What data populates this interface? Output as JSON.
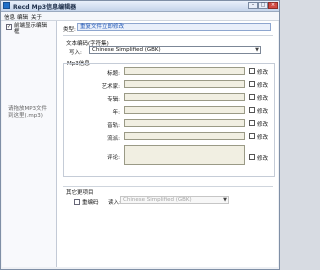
{
  "window": {
    "title": "Recd Mp3信息编辑器",
    "buttons": {
      "minimize": "–",
      "maximize": "□",
      "close": "×"
    }
  },
  "menu": [
    "信息",
    "编辑",
    "关于"
  ],
  "sidebar": {
    "preview_checked": true,
    "preview_label": "前端显示编辑框",
    "drop_hint": "请拖放MP3文件到这里(.mp3)"
  },
  "main": {
    "type_label": "类型:",
    "type_value": "重复文件立即修改",
    "encoding_label": "文本编码(字符集)",
    "write_label": "写入:",
    "encoding_value": "Chinese Simplified (GBK)",
    "mp3_label": "Mp3信息",
    "fields": [
      {
        "label": "标题:",
        "value": "",
        "modify_label": "修改",
        "checked": false
      },
      {
        "label": "艺术家:",
        "value": "",
        "modify_label": "修改",
        "checked": false
      },
      {
        "label": "专辑:",
        "value": "",
        "modify_label": "修改",
        "checked": false
      },
      {
        "label": "年:",
        "value": "",
        "modify_label": "修改",
        "checked": false
      },
      {
        "label": "音轨:",
        "value": "",
        "modify_label": "修改",
        "checked": false
      },
      {
        "label": "流派:",
        "value": "",
        "modify_label": "修改",
        "checked": false
      },
      {
        "label": "评论:",
        "value": "",
        "modify_label": "修改",
        "checked": false
      }
    ],
    "extra_label": "其它更项目",
    "reencode_label": "重编码",
    "read_label": "读入:",
    "read_value": "Chinese Simplified (GBK)"
  }
}
